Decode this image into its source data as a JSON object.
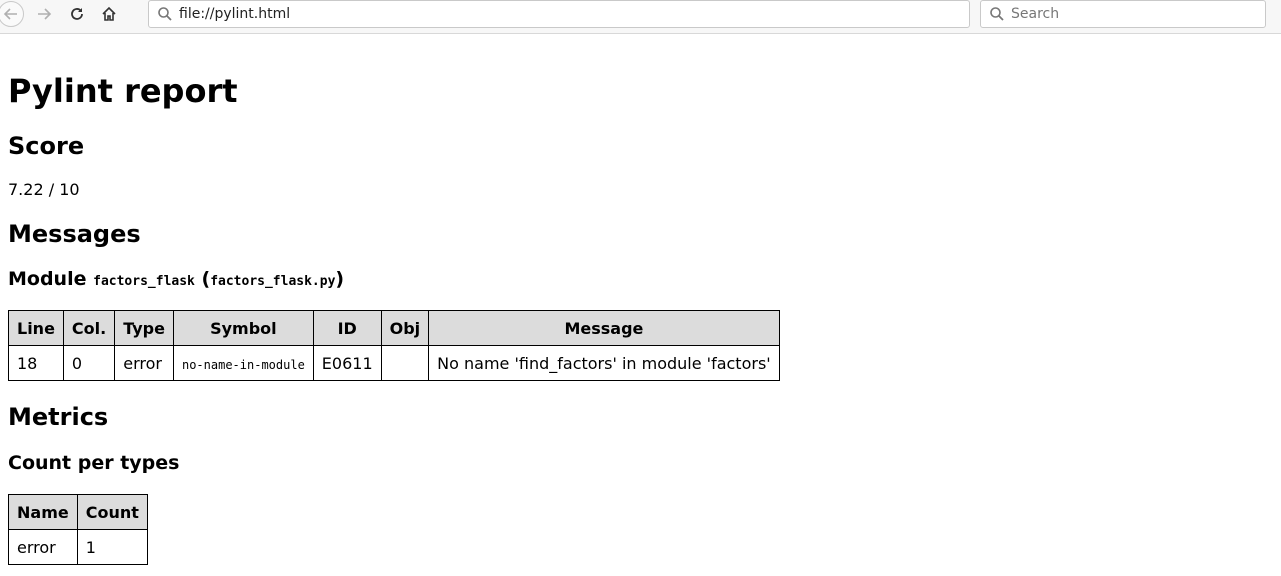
{
  "browser": {
    "url": "file://pylint.html",
    "search_placeholder": "Search"
  },
  "report": {
    "title": "Pylint report",
    "score_heading": "Score",
    "score_value": "7.22 / 10",
    "messages_heading": "Messages",
    "module_label": "Module",
    "module_name": "factors_flask",
    "module_file_open": "(",
    "module_file": "factors_flask.py",
    "module_file_close": ")",
    "messages_table": {
      "headers": [
        "Line",
        "Col.",
        "Type",
        "Symbol",
        "ID",
        "Obj",
        "Message"
      ],
      "rows": [
        [
          "18",
          "0",
          "error",
          "no-name-in-module",
          "E0611",
          "",
          "No name 'find_factors' in module 'factors'"
        ]
      ]
    },
    "metrics_heading": "Metrics",
    "count_heading": "Count per types",
    "count_table": {
      "headers": [
        "Name",
        "Count"
      ],
      "rows": [
        [
          "error",
          "1"
        ]
      ]
    }
  },
  "icons": {
    "back": "back-arrow-icon",
    "forward": "forward-arrow-icon",
    "reload": "reload-icon",
    "home": "home-icon",
    "search": "search-icon"
  }
}
